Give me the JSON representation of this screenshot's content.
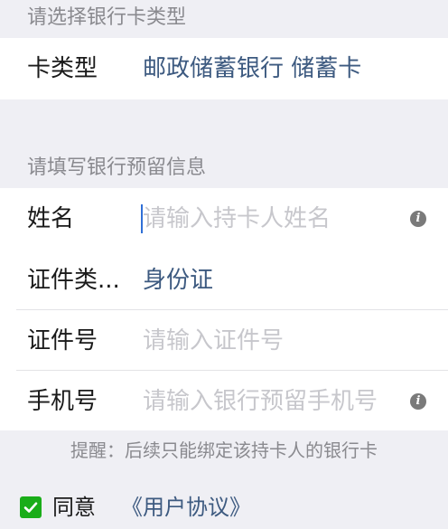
{
  "card_section": {
    "header": "请选择银行卡类型",
    "label": "卡类型",
    "value": "邮政储蓄银行 储蓄卡"
  },
  "info_section": {
    "header": "请填写银行预留信息",
    "name": {
      "label": "姓名",
      "placeholder": "请输入持卡人姓名",
      "info_icon": "info-icon"
    },
    "id_type": {
      "label": "证件类...",
      "value": "身份证"
    },
    "id_number": {
      "label": "证件号",
      "placeholder": "请输入证件号"
    },
    "phone": {
      "label": "手机号",
      "placeholder": "请输入银行预留手机号",
      "info_icon": "info-icon"
    }
  },
  "tip": "提醒：后续只能绑定该持卡人的银行卡",
  "agreement": {
    "checked": true,
    "agree_text": "同意",
    "link_text": "《用户协议》"
  },
  "colors": {
    "accent_value": "#3d5a80",
    "checkbox_green": "#1aad19",
    "placeholder": "#c7c7cc",
    "background": "#efeff4"
  }
}
